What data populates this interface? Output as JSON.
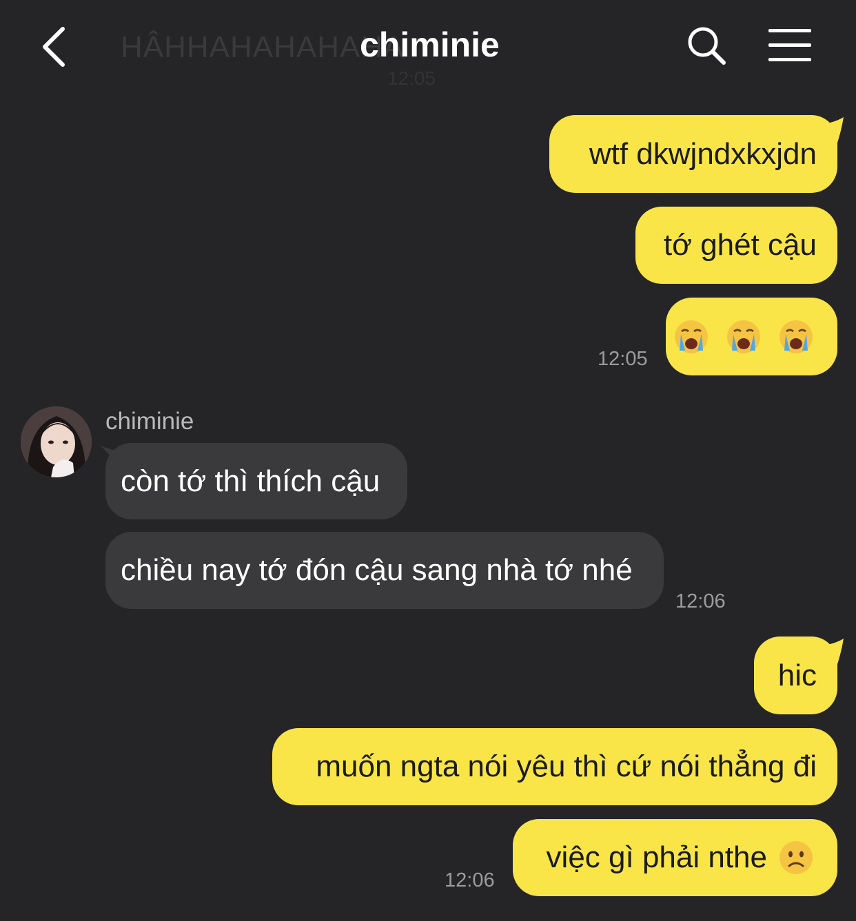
{
  "header": {
    "title": "chiminie",
    "ghost_text": "HÂHHAHAHAHAHA",
    "ghost_time": "12:05",
    "back_icon": "chevron-left-icon",
    "search_icon": "search-icon",
    "menu_icon": "hamburger-menu-icon"
  },
  "colors": {
    "background": "#252527",
    "outgoing_bubble": "#f9e547",
    "incoming_bubble": "#3a3a3c",
    "timestamp": "#9c9c9e"
  },
  "messages": {
    "m1": "wtf dkwjndxkxjdn",
    "m2": "tớ ghét cậu",
    "m3_emoji": "loudly-crying-face",
    "t1": "12:05",
    "sender": "chiminie",
    "m4": "còn tớ thì thích cậu",
    "m5": "chiều nay tớ đón cậu sang nhà tớ nhé",
    "t2": "12:06",
    "m6": "hic",
    "m7": "muốn ngta nói yêu thì cứ nói thẳng đi",
    "m8": "việc gì phải nthe",
    "m8_emoji": "slightly-frowning-face",
    "t3": "12:06"
  }
}
